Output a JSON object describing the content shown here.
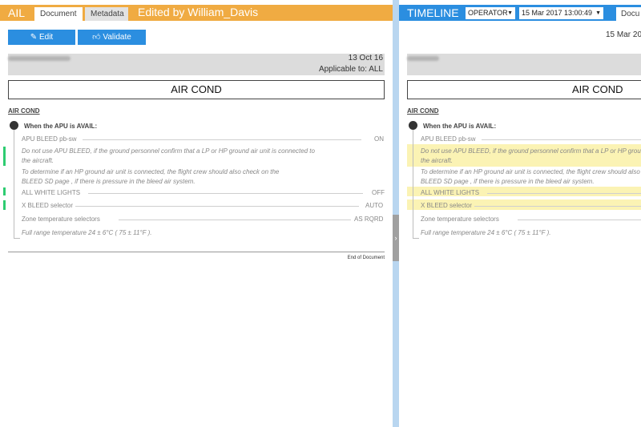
{
  "left_pane": {
    "header": {
      "title": "AIL",
      "tabs": [
        {
          "label": "Document",
          "active": true
        },
        {
          "label": "Metadata",
          "active": false
        }
      ],
      "edited_by": "Edited by William_Davis",
      "color": "#f0ab42"
    },
    "toolbar": {
      "edit_label": "Edit",
      "edit_icon": "pencil-icon",
      "validate_label": "Validate",
      "validate_icon": "thumbs-up-icon",
      "button_color": "#2b8ee0"
    },
    "meta": {
      "date": "13 Oct 16",
      "applicable": "Applicable to: ALL"
    },
    "section_title": "AIR COND",
    "content": {
      "heading": "AIR COND",
      "condition": "When the APU is AVAIL:",
      "items": [
        {
          "label": "APU BLEED pb-sw",
          "value": "ON"
        },
        {
          "label": "ALL WHITE LIGHTS",
          "value": "OFF"
        },
        {
          "label": "X BLEED selector",
          "value": "AUTO"
        },
        {
          "label": "Zone temperature selectors",
          "value": "AS RQRD"
        }
      ],
      "note_1": "Do not use APU BLEED, if the ground personnel confirm that a LP or HP ground air unit is connected to",
      "note_2": "the aircraft.",
      "note_3": "To determine if an HP ground air unit is connected, the flight crew should also check on the",
      "note_4": "BLEED SD page , if there is pressure in the bleed air system.",
      "note_5": "Full range temperature 24 ± 6°C ( 75 ± 11°F ).",
      "change_bar_color": "#2ecc71"
    },
    "end_label": "End of Document"
  },
  "right_pane": {
    "header": {
      "title": "TIMELINE",
      "operator_select": "OPERATOR",
      "date_select": "15 Mar 2017 13:00:49",
      "tab": "Docu",
      "color": "#2b8ee0"
    },
    "date": "15 Mar 20",
    "section_title": "AIR COND",
    "content": {
      "heading": "AIR COND",
      "condition": "When the APU is AVAIL:",
      "item_1": "APU BLEED pb-sw",
      "note_1": "Do not use APU BLEED, if the ground personnel confirm that a LP or HP ground air unit is connected",
      "note_2": "the aircraft.",
      "note_3": "To determine if an HP ground air unit is connected, the flight crew should also",
      "note_4": "BLEED SD page , if there is pressure in the bleed air system.",
      "item_2": "ALL WHITE LIGHTS",
      "item_3": "X BLEED selector",
      "item_4": "Zone temperature selectors",
      "note_5": "Full range temperature 24 ± 6°C ( 75 ± 11°F ).",
      "highlight_color": "#fbf3b4"
    }
  },
  "splitter": {
    "color": "#b9d6f0",
    "handle_icon": "chevron-right-icon"
  }
}
